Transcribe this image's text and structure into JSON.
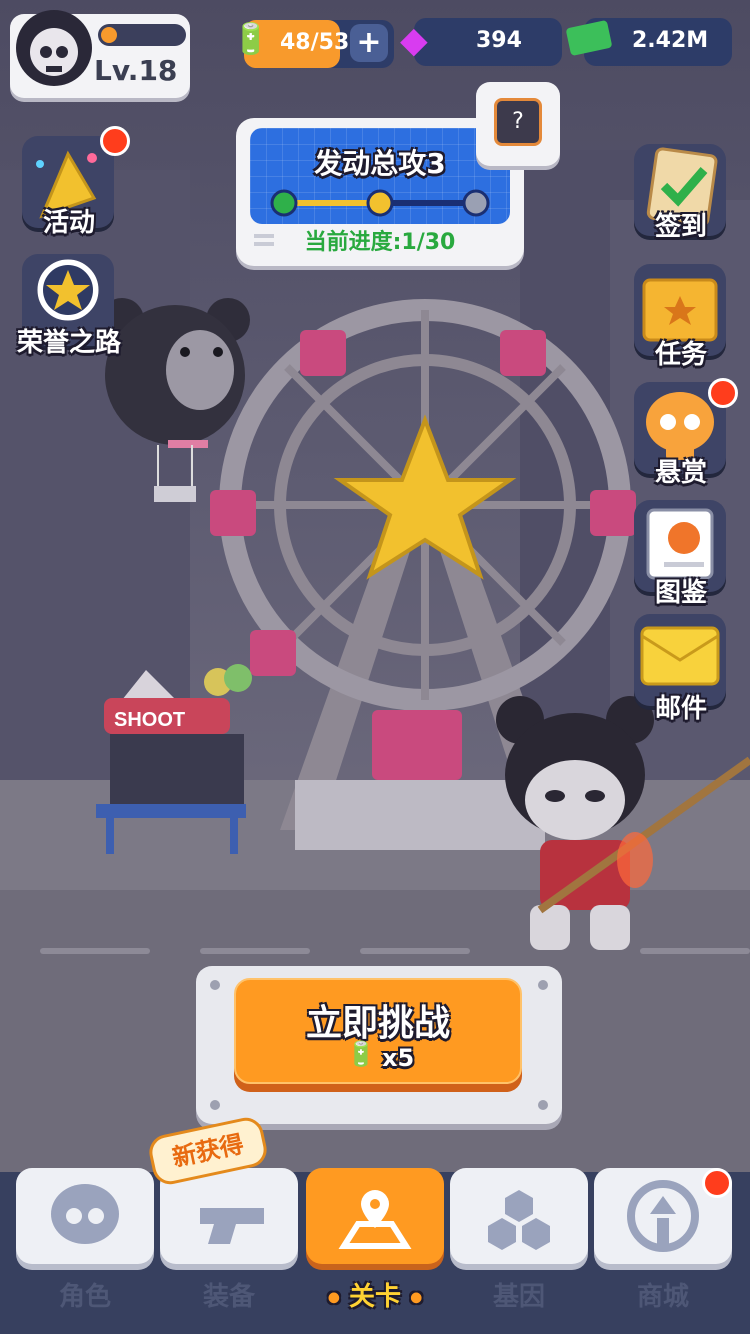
{
  "player": {
    "level": "Lv.18",
    "xp_progress": 0.12
  },
  "resources": {
    "energy": "48/53",
    "gems": "394",
    "cash": "2.42M"
  },
  "left_menu": [
    {
      "id": "events",
      "label": "活动",
      "badge": true
    },
    {
      "id": "honor",
      "label": "荣誉之路",
      "badge": false
    }
  ],
  "right_menu": [
    {
      "id": "signin",
      "label": "签到",
      "badge": false
    },
    {
      "id": "tasks",
      "label": "任务",
      "badge": false
    },
    {
      "id": "bounty",
      "label": "悬赏",
      "badge": true
    },
    {
      "id": "codex",
      "label": "图鉴",
      "badge": false
    },
    {
      "id": "mail",
      "label": "邮件",
      "badge": false
    }
  ],
  "quest": {
    "title": "发动总攻3",
    "progress_text": "当前进度:1/30",
    "step_current": 2,
    "step_total": 3
  },
  "scene": {
    "booth_sign": "SHOOT"
  },
  "challenge": {
    "label": "立即挑战",
    "cost": "x5"
  },
  "nav": [
    {
      "id": "character",
      "label": "角色",
      "active": false,
      "badge": false
    },
    {
      "id": "equipment",
      "label": "装备",
      "active": false,
      "badge": false,
      "tag": "新获得"
    },
    {
      "id": "stage",
      "label": "关卡",
      "active": true,
      "badge": false
    },
    {
      "id": "gene",
      "label": "基因",
      "active": false,
      "badge": false
    },
    {
      "id": "shop",
      "label": "商城",
      "active": false,
      "badge": true
    }
  ],
  "colors": {
    "accent": "#ff9a21",
    "badge": "#ff3d1c",
    "nav_bg": "#37405f",
    "panel": "#f3f3f6"
  }
}
